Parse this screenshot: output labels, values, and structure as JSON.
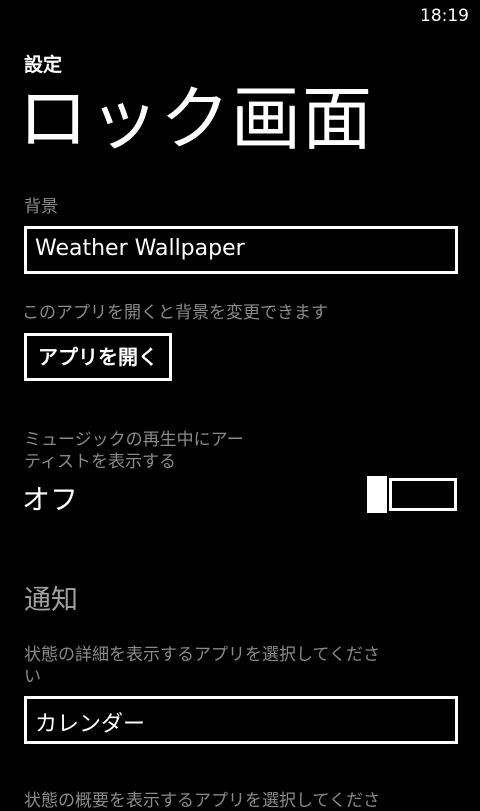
{
  "status_bar": {
    "time": "18:19"
  },
  "app_title": "設定",
  "page_title": "ロック画面",
  "background": {
    "label": "背景",
    "value": "Weather Wallpaper",
    "description": "このアプリを開くと背景を変更できます",
    "open_button_label": "アプリを開く"
  },
  "music_artist": {
    "label_line1": "ミュージックの再生中にアー",
    "label_line2": "ティストを表示する",
    "state": "オフ"
  },
  "notifications": {
    "header": "通知",
    "detailed_label_line1": "状態の詳細を表示するアプリを選択してくださ",
    "detailed_label_line2": "い",
    "detailed_value": "カレンダー",
    "quick_label": "状態の概要を表示するアプリを選択してくださ"
  }
}
